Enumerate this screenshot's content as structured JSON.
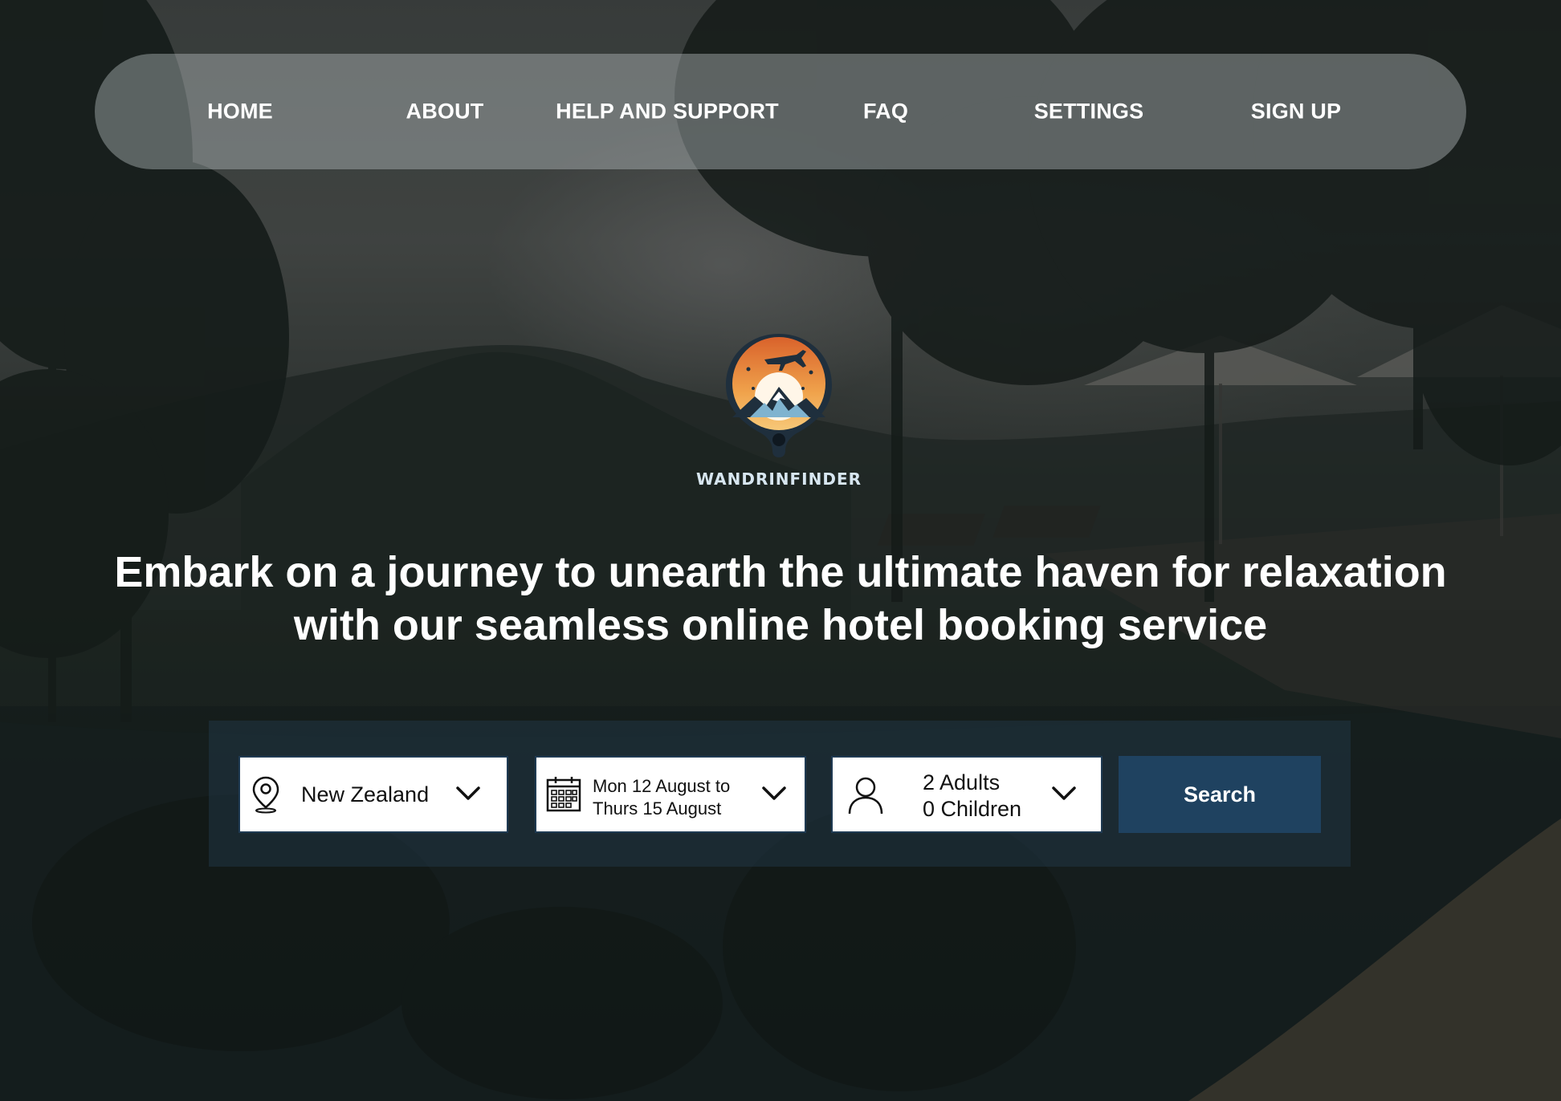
{
  "nav": {
    "items": [
      {
        "label": "HOME"
      },
      {
        "label": "ABOUT"
      },
      {
        "label": "HELP AND SUPPORT"
      },
      {
        "label": "FAQ"
      },
      {
        "label": "SETTINGS"
      },
      {
        "label": "SIGN UP"
      }
    ]
  },
  "brand": {
    "name": "WANDRINFINDER",
    "logo_icon": "mountain-plane-pin-logo",
    "colors": {
      "navy": "#1f3a52",
      "orange": "#e07a2c",
      "sky": "#f3b562",
      "mountain": "#7fb3cf"
    }
  },
  "hero": {
    "headline_line1": "Embark on a journey to unearth the ultimate haven for relaxation",
    "headline_line2": "with our seamless online hotel booking service"
  },
  "search": {
    "destination": {
      "value": "New Zealand",
      "icon": "map-pin-icon"
    },
    "dates": {
      "line1": "Mon 12 August to",
      "line2": "Thurs 15 August",
      "icon": "calendar-icon"
    },
    "guests": {
      "line1": "2 Adults",
      "line2": "0 Children",
      "icon": "person-icon"
    },
    "button_label": "Search",
    "button_color": "#1f4260"
  }
}
